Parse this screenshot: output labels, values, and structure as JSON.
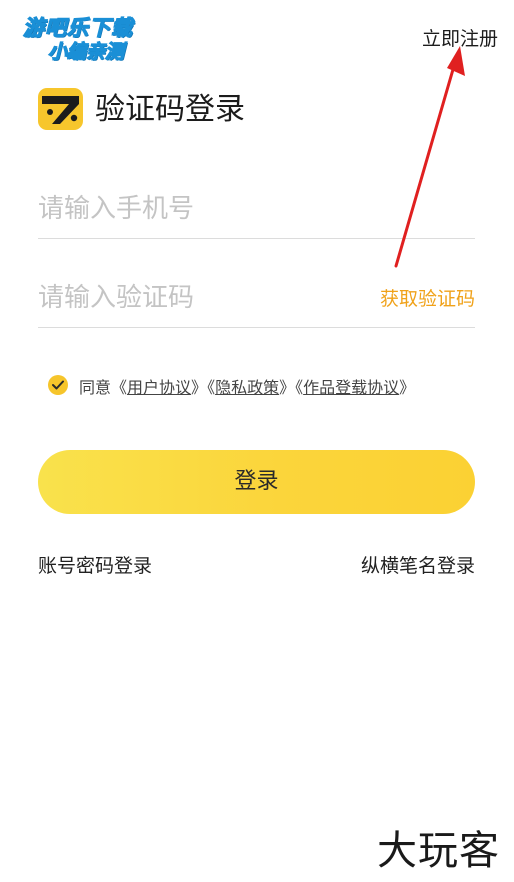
{
  "watermark": {
    "line1": "游吧乐下载",
    "line2": "小编亲测"
  },
  "header": {
    "register_label": "立即注册"
  },
  "title": "验证码登录",
  "form": {
    "phone_placeholder": "请输入手机号",
    "code_placeholder": "请输入验证码",
    "get_code_label": "获取验证码"
  },
  "agreement": {
    "checked": true,
    "prefix": "同意",
    "links": [
      {
        "open": "《",
        "label": "用户协议",
        "close": "》"
      },
      {
        "open": "《",
        "label": "隐私政策",
        "close": "》"
      },
      {
        "open": "《",
        "label": "作品登载协议",
        "close": "》"
      }
    ]
  },
  "login_button_label": "登录",
  "alt_logins": {
    "left": "账号密码登录",
    "right": "纵横笔名登录"
  },
  "brand_watermark": "大玩客",
  "colors": {
    "accent": "#fbd53b",
    "get_code": "#f0a21a",
    "arrow": "#e02020"
  }
}
